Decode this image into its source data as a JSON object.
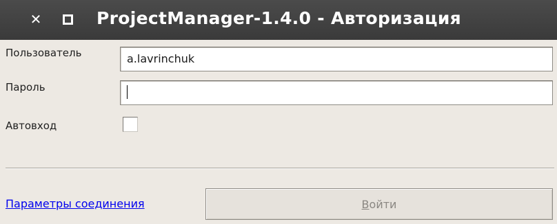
{
  "window": {
    "title": "ProjectManager-1.4.0 - Авторизация",
    "close_icon": "✕",
    "maximize_icon": "square"
  },
  "form": {
    "user_label": "Пользователь",
    "user_value": "a.lavrinchuk",
    "password_label": "Пароль",
    "password_value": "",
    "autologin_label": "Автовход",
    "autologin_checked": false
  },
  "footer": {
    "connection_link": "Параметры соединения",
    "login_button_mnemonic": "В",
    "login_button_rest": "ойти",
    "login_button_enabled": false
  },
  "colors": {
    "titlebar": "#3f3f3f",
    "window_bg": "#ede9e3",
    "link": "#0000ee",
    "disabled_text": "#8a8782"
  }
}
